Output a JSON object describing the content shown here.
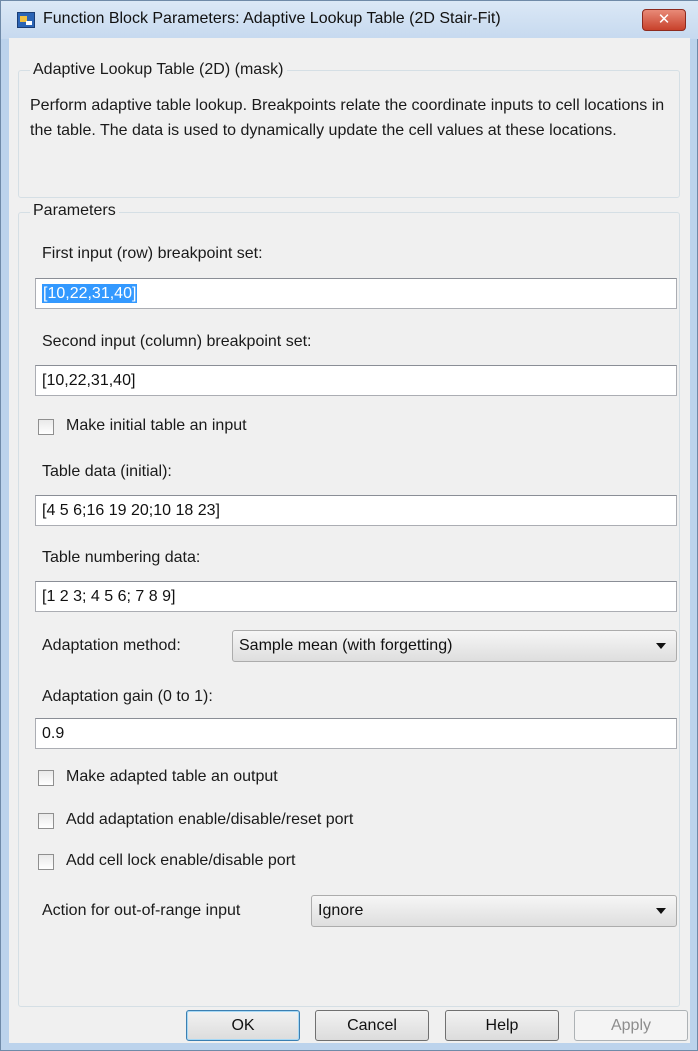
{
  "window": {
    "title": "Function Block Parameters: Adaptive Lookup Table (2D Stair-Fit)",
    "close_glyph": "✕"
  },
  "mask_group": {
    "title": "Adaptive Lookup Table (2D) (mask)",
    "description": "Perform adaptive table lookup.  Breakpoints relate the coordinate inputs to cell locations in the table.  The data is used to dynamically update the cell values at these locations."
  },
  "params_group": {
    "title": "Parameters",
    "row_breakpoints": {
      "label": "First input (row) breakpoint set:",
      "value": "[10,22,31,40]"
    },
    "col_breakpoints": {
      "label": "Second input (column) breakpoint set:",
      "value": "[10,22,31,40]"
    },
    "initial_table_input": {
      "label": "Make initial table an input",
      "checked": false
    },
    "table_data": {
      "label": "Table data (initial):",
      "value": "[4 5 6;16 19 20;10 18 23]"
    },
    "table_numbering": {
      "label": "Table numbering data:",
      "value": "[1 2 3; 4 5 6; 7 8 9]"
    },
    "adaptation_method": {
      "label": "Adaptation method:",
      "selected": "Sample mean (with forgetting)"
    },
    "adaptation_gain": {
      "label": "Adaptation gain (0 to 1):",
      "value": "0.9"
    },
    "adapted_table_output": {
      "label": "Make adapted table an output",
      "checked": false
    },
    "enable_reset_port": {
      "label": "Add adaptation enable/disable/reset port",
      "checked": false
    },
    "cell_lock_port": {
      "label": "Add cell lock enable/disable port",
      "checked": false
    },
    "out_of_range": {
      "label": "Action for out-of-range input",
      "selected": "Ignore"
    }
  },
  "buttons": {
    "ok": "OK",
    "cancel": "Cancel",
    "help": "Help",
    "apply": "Apply"
  },
  "colors": {
    "window_frame": "#bcd3ec",
    "client_bg": "#f0f0f0",
    "selection": "#3399ff",
    "close_button": "#c8412b"
  }
}
